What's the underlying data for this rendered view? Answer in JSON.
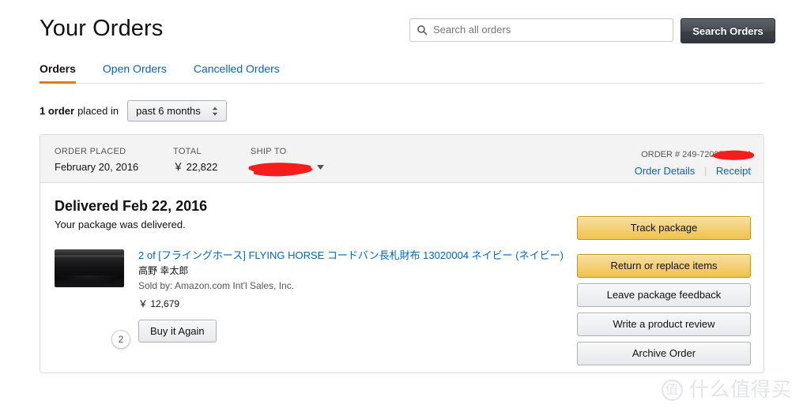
{
  "header": {
    "title": "Your Orders"
  },
  "search": {
    "placeholder": "Search all orders",
    "value": "",
    "icon": "search-icon",
    "button_label": "Search Orders"
  },
  "tabs": [
    {
      "label": "Orders",
      "active": true
    },
    {
      "label": "Open Orders",
      "active": false
    },
    {
      "label": "Cancelled Orders",
      "active": false
    }
  ],
  "filter": {
    "count_label": "1 order",
    "text": "placed in",
    "selected_range": "past 6 months"
  },
  "order": {
    "header": {
      "placed_label": "ORDER PLACED",
      "placed_value": "February 20, 2016",
      "total_label": "TOTAL",
      "total_value": "￥ 22,822",
      "ship_to_label": "SHIP TO",
      "ship_to_value": "",
      "ship_to_redacted": true,
      "order_number_label": "ORDER # 249-7208786-344",
      "order_number_redacted": true,
      "order_details_link": "Order Details",
      "receipt_link": "Receipt",
      "link_separator": "|"
    },
    "status": {
      "title": "Delivered Feb 22, 2016",
      "subtitle": "Your package was delivered."
    },
    "item": {
      "quantity_badge": "2",
      "title": "2 of [フライングホース] FLYING HORSE コードバン長札財布 13020004 ネイビー (ネイビー)",
      "byline": "高野 幸太郎",
      "seller": "Sold by: Amazon.com Int'l Sales, Inc.",
      "price": "￥ 12,679",
      "buy_again_label": "Buy it Again"
    },
    "actions": [
      {
        "label": "Track package",
        "style": "gold"
      },
      {
        "label": "Return or replace items",
        "style": "gold"
      },
      {
        "label": "Leave package feedback",
        "style": "gray"
      },
      {
        "label": "Write a product review",
        "style": "gray"
      },
      {
        "label": "Archive Order",
        "style": "gray"
      }
    ]
  },
  "watermark": {
    "mark": "值",
    "text": "什么值得买"
  },
  "colors": {
    "accent_orange": "#e47911",
    "link_blue": "#0066c0",
    "gold_button": "#f0c14b",
    "dark_button": "#474d52",
    "redaction_red": "#f61d1d",
    "card_header_gray": "#f3f3f3",
    "border_gray": "#dddddd"
  }
}
